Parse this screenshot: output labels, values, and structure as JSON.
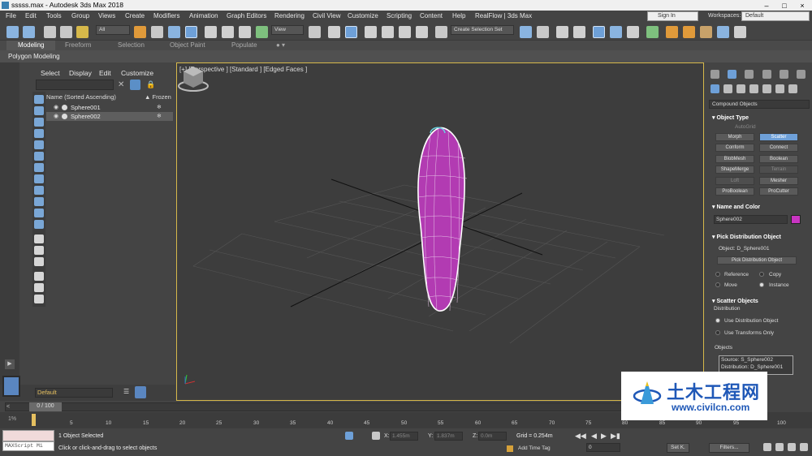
{
  "window": {
    "title": "sssss.max - Autodesk 3ds Max 2018",
    "controls": [
      "–",
      "□",
      "×"
    ]
  },
  "menubar": {
    "items": [
      "File",
      "Edit",
      "Tools",
      "Group",
      "Views",
      "Create",
      "Modifiers",
      "Animation",
      "Graph Editors",
      "Rendering",
      "Civil View",
      "Customize",
      "Scripting",
      "Content",
      "Help",
      "RealFlow | 3ds Max"
    ],
    "signin": "Sign In",
    "workspaces_label": "Workspaces:",
    "workspace_value": "Default"
  },
  "toolbar": {
    "filter_select": "All",
    "view_select": "View",
    "selection_set": "Create Selection Set"
  },
  "ribbon": {
    "tabs": [
      "Modeling",
      "Freeform",
      "Selection",
      "Object Paint",
      "Populate"
    ],
    "active_tab": "Modeling",
    "panel_label": "Polygon Modeling"
  },
  "scene_explorer": {
    "menus": [
      "Select",
      "Display",
      "Edit",
      "Customize"
    ],
    "column_name": "Name (Sorted Ascending)",
    "column_frozen": "▲ Frozen",
    "rows": [
      {
        "name": "Sphere001",
        "selected": false
      },
      {
        "name": "Sphere002",
        "selected": true
      }
    ],
    "frozen_icon": "❄",
    "eye_icon": "👁",
    "layer": "Default"
  },
  "viewport": {
    "label": "[+] [Perspective ] [Standard ] [Edged Faces ]",
    "object_color": "#b23bb2",
    "accent_border": "#d6b84a"
  },
  "command_panel": {
    "category": "Compound Objects",
    "object_type": {
      "title": "Object Type",
      "autogrid": "AutoGrid",
      "buttons": [
        {
          "label": "Morph",
          "state": "normal"
        },
        {
          "label": "Scatter",
          "state": "active"
        },
        {
          "label": "Conform",
          "state": "normal"
        },
        {
          "label": "Connect",
          "state": "normal"
        },
        {
          "label": "BlobMesh",
          "state": "normal"
        },
        {
          "label": "Boolean",
          "state": "normal"
        },
        {
          "label": "ShapeMerge",
          "state": "normal"
        },
        {
          "label": "Terrain",
          "state": "dim"
        },
        {
          "label": "Loft",
          "state": "dim"
        },
        {
          "label": "Mesher",
          "state": "normal"
        },
        {
          "label": "ProBoolean",
          "state": "normal"
        },
        {
          "label": "ProCutter",
          "state": "normal"
        }
      ]
    },
    "name_and_color": {
      "title": "Name and Color",
      "name": "Sphere002",
      "color": "#c935c2"
    },
    "pick_distribution": {
      "title": "Pick Distribution Object",
      "object_label": "Object: D_Sphere001",
      "button": "Pick Distribution Object",
      "radios": [
        {
          "label": "Reference",
          "on": false
        },
        {
          "label": "Copy",
          "on": false
        },
        {
          "label": "Move",
          "on": false
        },
        {
          "label": "Instance",
          "on": true
        }
      ]
    },
    "scatter_objects": {
      "title": "Scatter Objects",
      "distribution_label": "Distribution",
      "options": [
        {
          "label": "Use Distribution Object",
          "on": true
        },
        {
          "label": "Use Transforms Only",
          "on": false
        }
      ],
      "objects_label": "Objects",
      "objects_list": [
        "Source: S_Sphere002",
        "Distribution: D_Sphere001"
      ]
    }
  },
  "timeline": {
    "slider": "0 / 100",
    "ruler_labels": [
      "5",
      "10",
      "15",
      "20",
      "25",
      "30",
      "35",
      "40",
      "45",
      "50",
      "55",
      "60",
      "65",
      "70",
      "75",
      "80",
      "85",
      "90",
      "95",
      "100"
    ],
    "frame_icon": "1%"
  },
  "status": {
    "maxscript": "MAXScript Mi",
    "selected": "1 Object Selected",
    "prompt": "Click or click-and-drag to select objects",
    "x_label": "X:",
    "x_value": "1.455m",
    "y_label": "Y:",
    "y_value": "1.837m",
    "z_label": "Z:",
    "z_value": "0.0m",
    "grid": "Grid = 0.254m",
    "add_time_tag": "Add Time Tag",
    "frame_value": "0",
    "set_key": "Set K.",
    "filters": "Filters..."
  },
  "watermark": {
    "chinese": "土木工程网",
    "url": "www.civilcn.com"
  }
}
